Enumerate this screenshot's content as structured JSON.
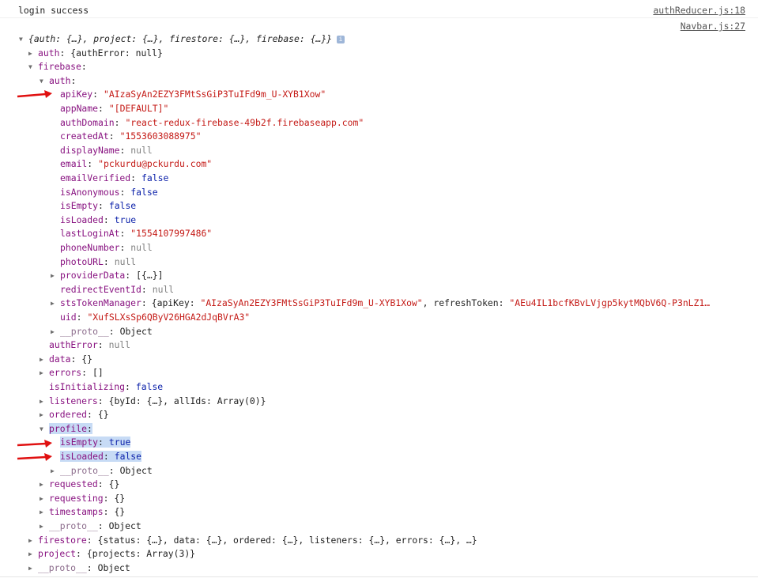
{
  "console": {
    "message": "login success",
    "source_top": "authReducer.js:18",
    "source_bottom": "Navbar.js:27",
    "object_preview": "{auth: {…}, project: {…}, firestore: {…}, firebase: {…}}",
    "info_glyph": "i"
  },
  "tree": [
    {
      "indent": 0,
      "tri": "▼",
      "key": "",
      "value": "{auth: {…}, project: {…}, firestore: {…}, firebase: {…}}",
      "vtype": "preview"
    },
    {
      "indent": 1,
      "tri": "▶",
      "key": "auth",
      "value": "{authError: null}",
      "vtype": "plain"
    },
    {
      "indent": 1,
      "tri": "▼",
      "key": "firebase",
      "value": "",
      "vtype": "plain"
    },
    {
      "indent": 2,
      "tri": "▼",
      "key": "auth",
      "value": "",
      "vtype": "plain"
    },
    {
      "indent": 3,
      "tri": "",
      "key": "apiKey",
      "value": "\"AIzaSyAn2EZY3FMtSsGiP3TuIFd9m_U-XYB1Xow\"",
      "vtype": "str"
    },
    {
      "indent": 3,
      "tri": "",
      "key": "appName",
      "value": "\"[DEFAULT]\"",
      "vtype": "str"
    },
    {
      "indent": 3,
      "tri": "",
      "key": "authDomain",
      "value": "\"react-redux-firebase-49b2f.firebaseapp.com\"",
      "vtype": "str"
    },
    {
      "indent": 3,
      "tri": "",
      "key": "createdAt",
      "value": "\"1553603088975\"",
      "vtype": "str"
    },
    {
      "indent": 3,
      "tri": "",
      "key": "displayName",
      "value": "null",
      "vtype": "null"
    },
    {
      "indent": 3,
      "tri": "",
      "key": "email",
      "value": "\"pckurdu@pckurdu.com\"",
      "vtype": "str"
    },
    {
      "indent": 3,
      "tri": "",
      "key": "emailVerified",
      "value": "false",
      "vtype": "bool"
    },
    {
      "indent": 3,
      "tri": "",
      "key": "isAnonymous",
      "value": "false",
      "vtype": "bool"
    },
    {
      "indent": 3,
      "tri": "",
      "key": "isEmpty",
      "value": "false",
      "vtype": "bool"
    },
    {
      "indent": 3,
      "tri": "",
      "key": "isLoaded",
      "value": "true",
      "vtype": "bool"
    },
    {
      "indent": 3,
      "tri": "",
      "key": "lastLoginAt",
      "value": "\"1554107997486\"",
      "vtype": "str"
    },
    {
      "indent": 3,
      "tri": "",
      "key": "phoneNumber",
      "value": "null",
      "vtype": "null"
    },
    {
      "indent": 3,
      "tri": "",
      "key": "photoURL",
      "value": "null",
      "vtype": "null"
    },
    {
      "indent": 3,
      "tri": "▶",
      "key": "providerData",
      "value": "[{…}]",
      "vtype": "plain"
    },
    {
      "indent": 3,
      "tri": "",
      "key": "redirectEventId",
      "value": "null",
      "vtype": "null"
    },
    {
      "indent": 3,
      "tri": "▶",
      "key": "stsTokenManager",
      "value": "",
      "vtype": "sts"
    },
    {
      "indent": 3,
      "tri": "",
      "key": "uid",
      "value": "\"XufSLXsSp6QByV26HGA2dJqBVrA3\"",
      "vtype": "str"
    },
    {
      "indent": 3,
      "tri": "▶",
      "key": "__proto__",
      "value": "Object",
      "vtype": "plain",
      "dim": true
    },
    {
      "indent": 2,
      "tri": "",
      "key": "authError",
      "value": "null",
      "vtype": "null"
    },
    {
      "indent": 2,
      "tri": "▶",
      "key": "data",
      "value": "{}",
      "vtype": "plain"
    },
    {
      "indent": 2,
      "tri": "▶",
      "key": "errors",
      "value": "[]",
      "vtype": "plain"
    },
    {
      "indent": 2,
      "tri": "",
      "key": "isInitializing",
      "value": "false",
      "vtype": "bool"
    },
    {
      "indent": 2,
      "tri": "▶",
      "key": "listeners",
      "value": "{byId: {…}, allIds: Array(0)}",
      "vtype": "plain"
    },
    {
      "indent": 2,
      "tri": "▶",
      "key": "ordered",
      "value": "{}",
      "vtype": "plain"
    },
    {
      "indent": 2,
      "tri": "▼",
      "key": "profile",
      "value": "",
      "vtype": "plain",
      "hl": true
    },
    {
      "indent": 3,
      "tri": "",
      "key": "isEmpty",
      "value": "true",
      "vtype": "bool",
      "hl": true
    },
    {
      "indent": 3,
      "tri": "",
      "key": "isLoaded",
      "value": "false",
      "vtype": "bool",
      "hl": true
    },
    {
      "indent": 3,
      "tri": "▶",
      "key": "__proto__",
      "value": "Object",
      "vtype": "plain",
      "dim": true
    },
    {
      "indent": 2,
      "tri": "▶",
      "key": "requested",
      "value": "{}",
      "vtype": "plain"
    },
    {
      "indent": 2,
      "tri": "▶",
      "key": "requesting",
      "value": "{}",
      "vtype": "plain"
    },
    {
      "indent": 2,
      "tri": "▶",
      "key": "timestamps",
      "value": "{}",
      "vtype": "plain"
    },
    {
      "indent": 2,
      "tri": "▶",
      "key": "__proto__",
      "value": "Object",
      "vtype": "plain",
      "dim": true
    },
    {
      "indent": 1,
      "tri": "▶",
      "key": "firestore",
      "value": "{status: {…}, data: {…}, ordered: {…}, listeners: {…}, errors: {…}, …}",
      "vtype": "plain"
    },
    {
      "indent": 1,
      "tri": "▶",
      "key": "project",
      "value": "{projects: Array(3)}",
      "vtype": "plain"
    },
    {
      "indent": 1,
      "tri": "▶",
      "key": "__proto__",
      "value": "Object",
      "vtype": "plain",
      "dim": true
    }
  ],
  "sts": {
    "open": "{",
    "k1": "apiKey",
    "v1": "\"AIzaSyAn2EZY3FMtSsGiP3TuIFd9m_U-XYB1Xow\"",
    "comma": ", ",
    "k2": "refreshToken",
    "v2": "\"AEu4IL1bcfKBvLVjgp5kytMQbV6Q-P3nLZ1…"
  },
  "colors": {
    "key": "#881280",
    "string": "#c41a16",
    "boolean": "#0d22aa",
    "null": "#808080",
    "highlight": "#c7dbf5",
    "arrow": "#e01010"
  }
}
